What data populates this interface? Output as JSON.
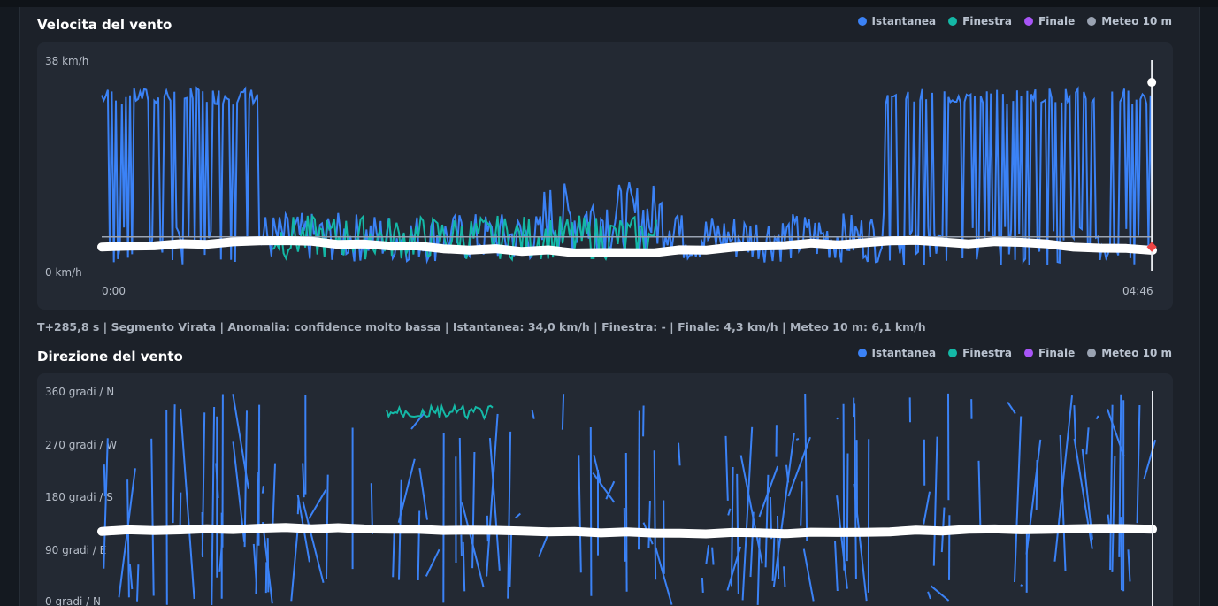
{
  "speed_chart": {
    "title": "Velocita del vento",
    "legend": [
      {
        "label": "Istantanea",
        "color": "#3b82f6"
      },
      {
        "label": "Finestra",
        "color": "#14b8a6"
      },
      {
        "label": "Finale",
        "color": "#a855f7"
      },
      {
        "label": "Meteo 10 m",
        "color": "#9aa3b2"
      }
    ],
    "y_top_label": "38 km/h",
    "y_bottom_label": "0 km/h",
    "x_start_label": "0:00",
    "x_end_label": "04:46"
  },
  "status_line": "T+285,8 s | Segmento Virata | Anomalia: confidence molto bassa | Istantanea: 34,0 km/h | Finestra: - | Finale: 4,3 km/h | Meteo 10 m: 6,1 km/h",
  "direction_chart": {
    "title": "Direzione del vento",
    "legend": [
      {
        "label": "Istantanea",
        "color": "#3b82f6"
      },
      {
        "label": "Finestra",
        "color": "#14b8a6"
      },
      {
        "label": "Finale",
        "color": "#a855f7"
      },
      {
        "label": "Meteo 10 m",
        "color": "#9aa3b2"
      }
    ],
    "y_labels": [
      "360 gradi / N",
      "270 gradi / W",
      "180 gradi / S",
      "90 gradi / E",
      "0 gradi / N"
    ]
  },
  "chart_data": [
    {
      "type": "line",
      "title": "Velocita del vento",
      "ylim": [
        0,
        38
      ],
      "xlim": [
        0,
        286
      ],
      "series": [
        {
          "name": "Istantanea",
          "color": "#3b82f6"
        },
        {
          "name": "Finestra",
          "color": "#14b8a6"
        },
        {
          "name": "Finale",
          "color": "#a855f7"
        },
        {
          "name": "Meteo 10 m",
          "color": "#9aa3b2",
          "values_approx": 6.1
        }
      ],
      "cursor": {
        "t": 285.8,
        "istantanea": 34.0,
        "finale": 4.3,
        "meteo": 6.1
      }
    },
    {
      "type": "line",
      "title": "Direzione del vento",
      "ylim": [
        0,
        360
      ],
      "series": [
        {
          "name": "Istantanea",
          "color": "#3b82f6"
        },
        {
          "name": "Finestra",
          "color": "#14b8a6"
        },
        {
          "name": "Finale",
          "color": "#a855f7"
        },
        {
          "name": "Meteo 10 m",
          "color": "#9aa3b2"
        }
      ]
    }
  ]
}
